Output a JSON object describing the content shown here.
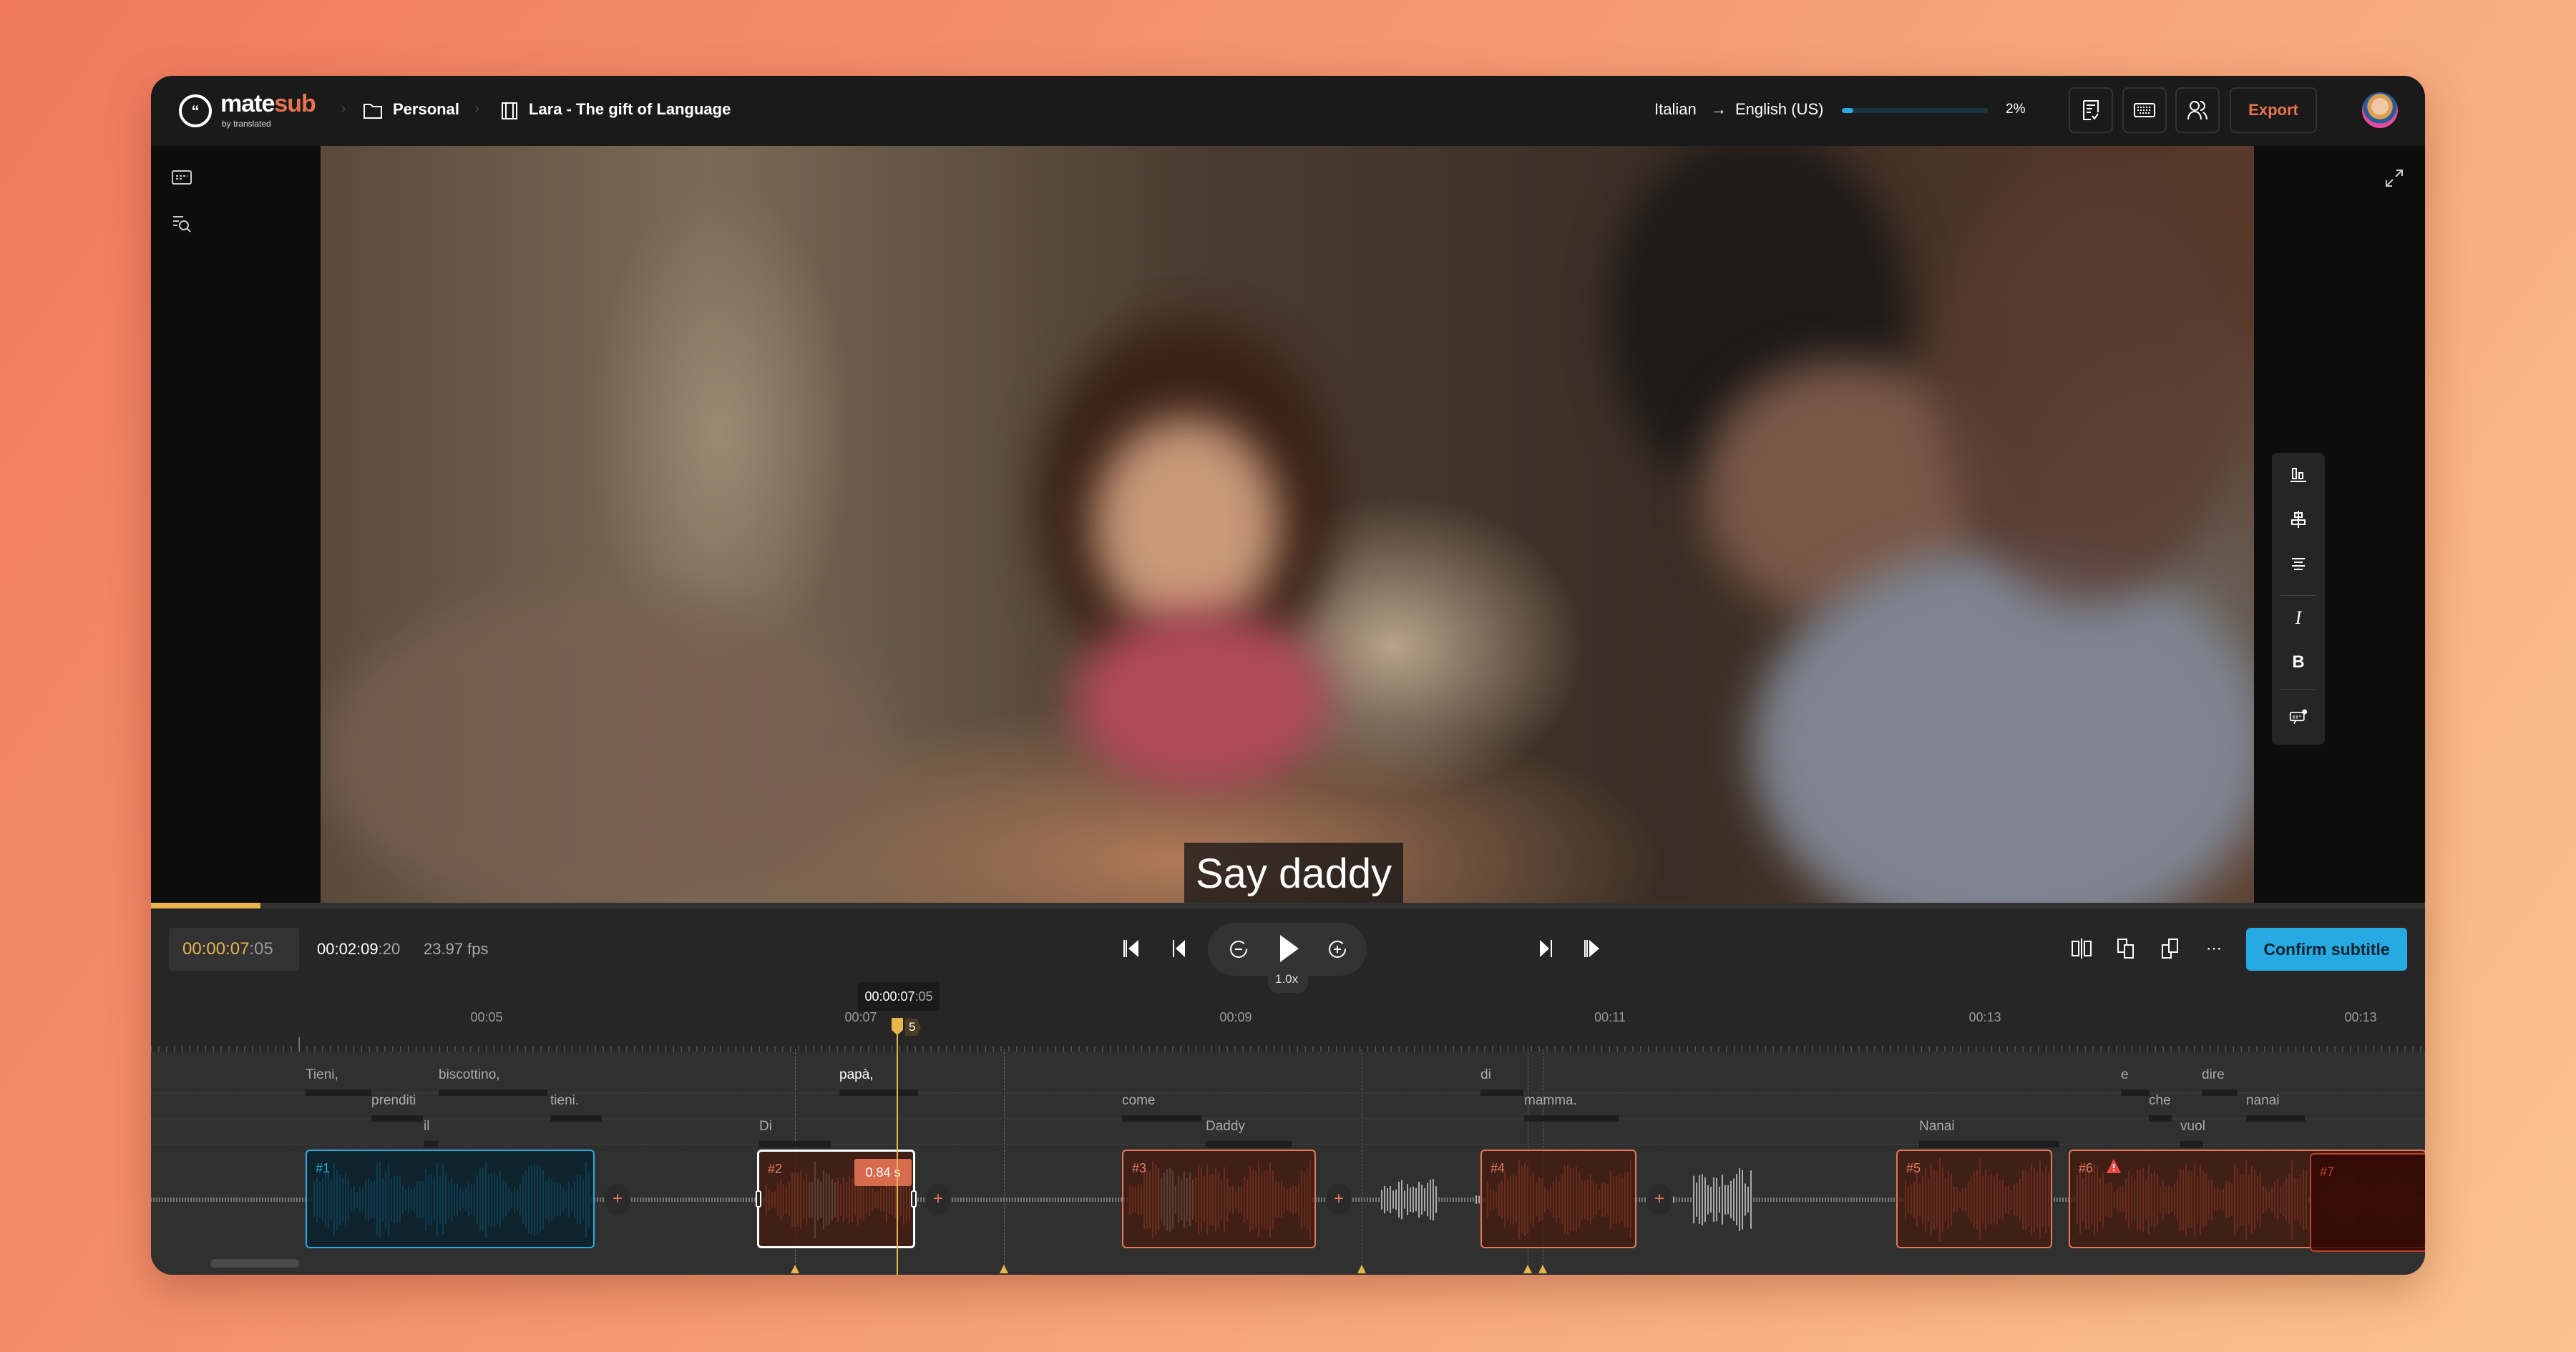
{
  "header": {
    "logo_main": "mate",
    "logo_accent": "sub",
    "logo_sub": "by translated",
    "breadcrumb": [
      {
        "label": "Personal",
        "icon": "folder-icon"
      },
      {
        "label": "Lara - The gift of Language",
        "icon": "film-icon"
      }
    ],
    "source_language": "Italian",
    "target_language": "English (US)",
    "progress_percent": 2,
    "progress_label": "2%",
    "export_label": "Export"
  },
  "video": {
    "subtitle_text": "Say daddy",
    "playback_progress_percent": 4.8
  },
  "player": {
    "current_time_main": "00:00:07",
    "current_time_frames": ":05",
    "duration_main": "00:02:09",
    "duration_frames": ":20",
    "fps": "23.97 fps",
    "speed": "1.0x",
    "confirm_label": "Confirm subtitle"
  },
  "timeline": {
    "playhead_tooltip_main": "00:00:07",
    "playhead_tooltip_frames": ":05",
    "playhead_frame_badge": "5",
    "ruler_labels": [
      "00:05",
      "00:07",
      "00:09",
      "00:11",
      "00:13",
      "00:13"
    ],
    "words_row1": [
      "Tieni,",
      "biscottino,",
      "papà,",
      "di",
      "e",
      "dire"
    ],
    "words_row2": [
      "prenditi",
      "tieni.",
      "come",
      "mamma.",
      "che",
      "nanai"
    ],
    "words_row3": [
      "il",
      "Di",
      "Daddy",
      "Nanai",
      "vuol"
    ],
    "segments": [
      {
        "label": "#1",
        "state": "active"
      },
      {
        "label": "#2",
        "state": "selected",
        "duration": "0.84 s"
      },
      {
        "label": "#3",
        "state": "normal"
      },
      {
        "label": "#4",
        "state": "normal"
      },
      {
        "label": "#5",
        "state": "normal"
      },
      {
        "label": "#6",
        "state": "warning"
      },
      {
        "label": "#7",
        "state": "overlap"
      }
    ]
  },
  "colors": {
    "accent_orange": "#e8734f",
    "accent_blue": "#27a9e1",
    "playhead_yellow": "#e8b54a"
  }
}
